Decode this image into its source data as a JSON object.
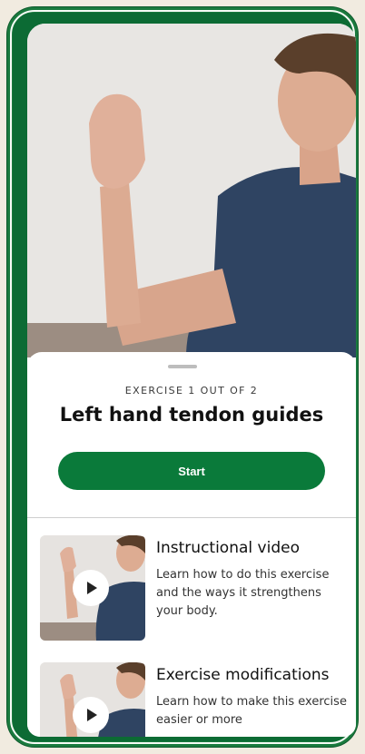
{
  "sheet": {
    "kicker": "EXERCISE  1 OUT OF 2",
    "title": "Left hand tendon guides",
    "start_label": "Start"
  },
  "items": [
    {
      "title": "Instructional video",
      "desc": "Learn how to do this exercise and the ways it strengthens your body."
    },
    {
      "title": "Exercise modifications",
      "desc": "Learn how to make this exercise easier or more"
    }
  ],
  "colors": {
    "frame_green": "#1a7a3e",
    "button_green": "#0a7a3a",
    "background": "#f1ebe0"
  },
  "icons": [
    "play-icon",
    "drag-handle"
  ]
}
